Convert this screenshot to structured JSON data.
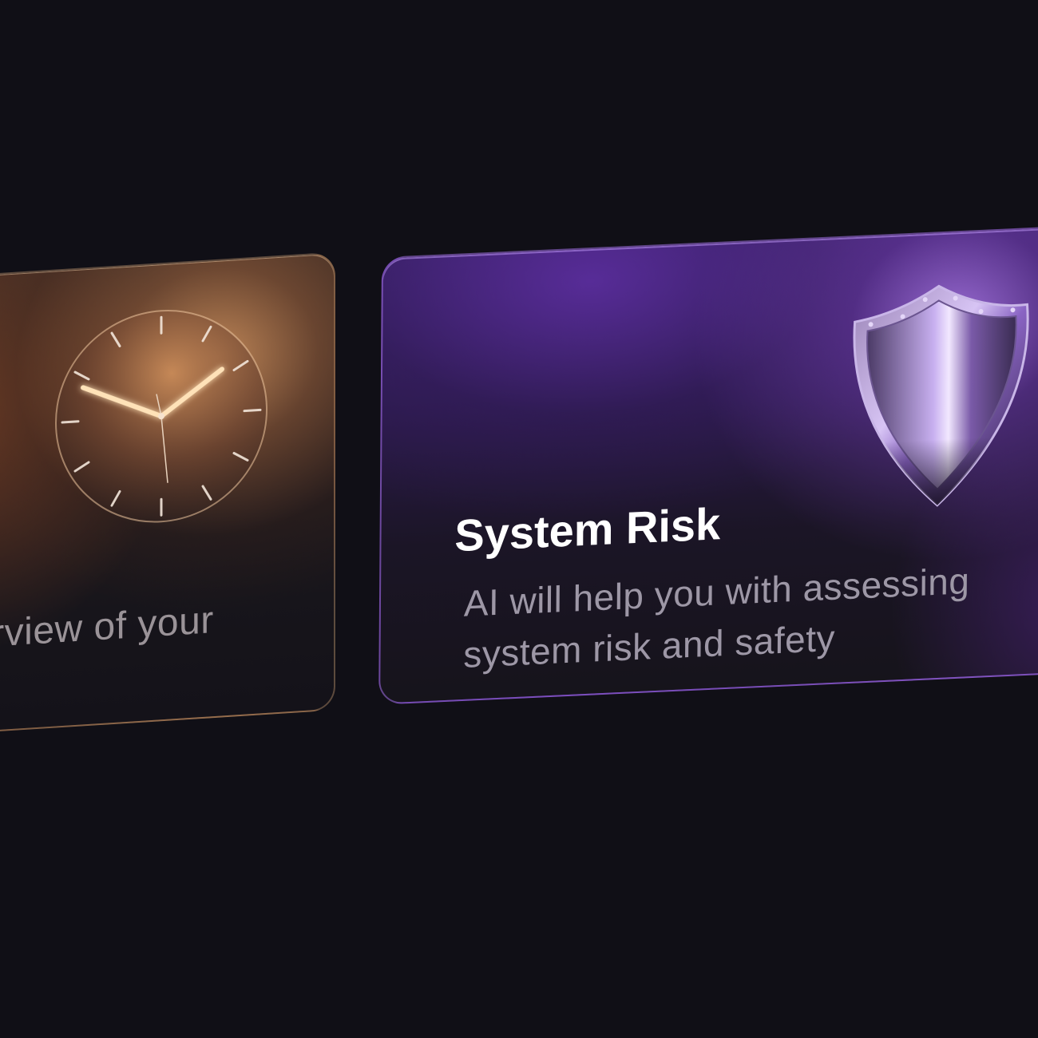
{
  "background_color": "#100f16",
  "cards": [
    {
      "id": "clock-card",
      "icon": "clock-icon",
      "accent": "#d69660",
      "text": "erview of your"
    },
    {
      "id": "system-risk-card",
      "icon": "shield-icon",
      "accent": "#8a4fd6",
      "title": "System Risk",
      "description": "AI will help you with assessing system risk and safety"
    }
  ]
}
